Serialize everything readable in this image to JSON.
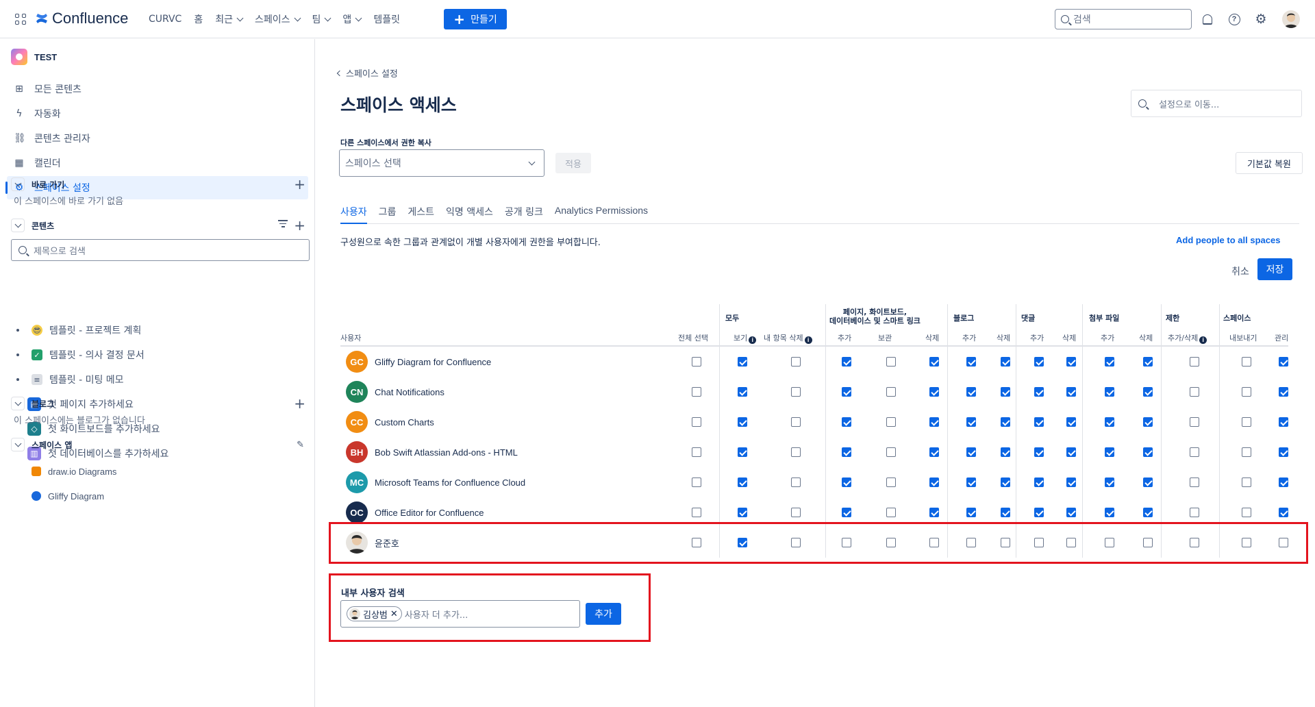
{
  "topnav": {
    "brand": "Confluence",
    "items": [
      {
        "label": "CURVC",
        "dropdown": false
      },
      {
        "label": "홈",
        "dropdown": false
      },
      {
        "label": "최근",
        "dropdown": true
      },
      {
        "label": "스페이스",
        "dropdown": true
      },
      {
        "label": "팀",
        "dropdown": true
      },
      {
        "label": "앱",
        "dropdown": true
      },
      {
        "label": "템플릿",
        "dropdown": false
      }
    ],
    "create_label": "만들기",
    "search_placeholder": "검색"
  },
  "sidebar": {
    "space_name": "TEST",
    "items": [
      {
        "label": "모든 콘텐츠",
        "icon": "grid-icon"
      },
      {
        "label": "자동화",
        "icon": "lightning-icon"
      },
      {
        "label": "콘텐츠 관리자",
        "icon": "content-manager-icon"
      },
      {
        "label": "캘린더",
        "icon": "calendar-icon"
      },
      {
        "label": "스페이스 설정",
        "icon": "gear-icon",
        "active": true
      }
    ],
    "shortcuts": {
      "title": "바로 가기",
      "empty": "이 스페이스에 바로 가기 없음"
    },
    "content": {
      "title": "콘텐츠",
      "search_placeholder": "제목으로 검색",
      "tree": [
        {
          "label": "템플릿 - 프로젝트 계획",
          "icon": "sunglasses-emoji-icon"
        },
        {
          "label": "템플릿 - 의사 결정 문서",
          "icon": "check-emoji-icon"
        },
        {
          "label": "템플릿 - 미팅 메모",
          "icon": "memo-emoji-icon"
        }
      ],
      "add_items": [
        {
          "label": "첫 페이지 추가하세요",
          "icon": "page-icon"
        },
        {
          "label": "첫 화이트보드를 추가하세요",
          "icon": "whiteboard-icon"
        },
        {
          "label": "첫 데이터베이스를 추가하세요",
          "icon": "database-icon"
        }
      ]
    },
    "blog": {
      "title": "블로그",
      "empty": "이 스페이스에는 블로그가 없습니다"
    },
    "apps": {
      "title": "스페이스 앱",
      "items": [
        {
          "label": "draw.io Diagrams",
          "icon": "drawio-icon"
        },
        {
          "label": "Gliffy Diagram",
          "icon": "gliffy-icon"
        }
      ]
    }
  },
  "main": {
    "back_label": "스페이스 설정",
    "title": "스페이스 액세스",
    "settings_search_placeholder": "설정으로 이동...",
    "copy_label": "다른 스페이스에서 권한 복사",
    "space_select_placeholder": "스페이스 선택",
    "apply_label": "적용",
    "reset_label": "기본값 복원",
    "tabs": [
      "사용자",
      "그룹",
      "게스트",
      "익명 액세스",
      "공개 링크",
      "Analytics Permissions"
    ],
    "description": "구성원으로 속한 그룹과 관계없이 개별 사용자에게 권한을 부여합니다.",
    "add_all_label": "Add people to all spaces",
    "cancel_label": "취소",
    "save_label": "저장"
  },
  "permissions": {
    "user_header": "사용자",
    "select_all_header": "전체 선택",
    "groups": [
      {
        "label": "모두"
      },
      {
        "label": "페이지, 화이트보드,\n데이터베이스 및 스마트 링크"
      },
      {
        "label": "블로그"
      },
      {
        "label": "댓글"
      },
      {
        "label": "첨부 파일"
      },
      {
        "label": "제한"
      },
      {
        "label": "스페이스"
      }
    ],
    "columns": [
      "보기",
      "내 항목 삭제",
      "추가",
      "보관",
      "삭제",
      "추가",
      "삭제",
      "추가",
      "삭제",
      "추가",
      "삭제",
      "추가/삭제",
      "내보내기",
      "관리"
    ],
    "rows": [
      {
        "initials": "GC",
        "name": "Gliffy Diagram for Confluence",
        "color": "#f18d13",
        "select_all": false,
        "perms": [
          true,
          false,
          true,
          false,
          true,
          true,
          true,
          true,
          true,
          true,
          true,
          false,
          false,
          true
        ]
      },
      {
        "initials": "CN",
        "name": "Chat Notifications",
        "color": "#1f845a",
        "select_all": false,
        "perms": [
          true,
          false,
          true,
          false,
          true,
          true,
          true,
          true,
          true,
          true,
          true,
          false,
          false,
          true
        ]
      },
      {
        "initials": "CC",
        "name": "Custom Charts",
        "color": "#f18d13",
        "select_all": false,
        "perms": [
          true,
          false,
          true,
          false,
          true,
          true,
          true,
          true,
          true,
          true,
          true,
          false,
          false,
          true
        ]
      },
      {
        "initials": "BH",
        "name": "Bob Swift Atlassian Add-ons - HTML",
        "color": "#c9372c",
        "select_all": false,
        "perms": [
          true,
          false,
          true,
          false,
          true,
          true,
          true,
          true,
          true,
          true,
          true,
          false,
          false,
          true
        ]
      },
      {
        "initials": "MC",
        "name": "Microsoft Teams for Confluence Cloud",
        "color": "#1d9aaa",
        "select_all": false,
        "perms": [
          true,
          false,
          true,
          false,
          true,
          true,
          true,
          true,
          true,
          true,
          true,
          false,
          false,
          true
        ]
      },
      {
        "initials": "OC",
        "name": "Office Editor for Confluence",
        "color": "#172b4d",
        "select_all": false,
        "perms": [
          true,
          false,
          true,
          false,
          true,
          true,
          true,
          true,
          true,
          true,
          true,
          false,
          false,
          true
        ]
      },
      {
        "initials": "",
        "name": "윤준호",
        "color": "#e7e4df",
        "photo": true,
        "select_all": false,
        "perms": [
          true,
          false,
          false,
          false,
          false,
          false,
          false,
          false,
          false,
          false,
          false,
          false,
          false,
          false
        ]
      }
    ]
  },
  "invite": {
    "title": "내부 사용자 검색",
    "chip_name": "김상범",
    "placeholder": "사용자 더 추가...",
    "add_label": "추가"
  },
  "colors": {
    "accent": "#0c66e4",
    "highlight": "#e3141e"
  }
}
